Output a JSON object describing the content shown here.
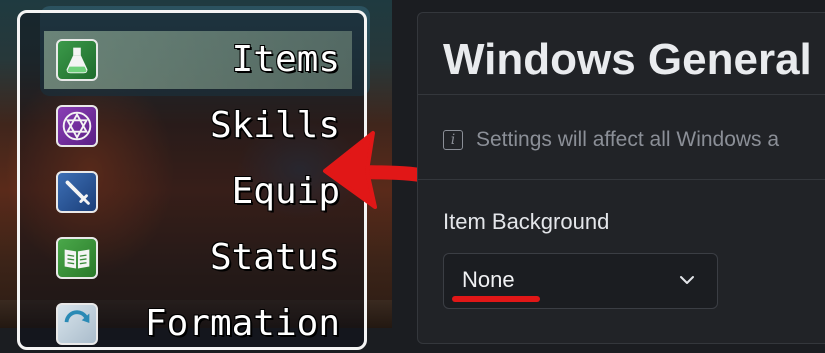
{
  "game_menu": {
    "items": [
      {
        "label": "Items",
        "icon": "potion-icon",
        "selected": true
      },
      {
        "label": "Skills",
        "icon": "hexagram-icon",
        "selected": false
      },
      {
        "label": "Equip",
        "icon": "sword-icon",
        "selected": false
      },
      {
        "label": "Status",
        "icon": "book-icon",
        "selected": false
      },
      {
        "label": "Formation",
        "icon": "cycle-icon",
        "selected": false
      }
    ]
  },
  "annotation": {
    "arrow_color": "#e11717"
  },
  "settings_panel": {
    "title": "Windows General",
    "info_text": "Settings will affect all Windows a",
    "item_background": {
      "label": "Item Background",
      "value": "None"
    }
  },
  "colors": {
    "panel_bg": "#212327",
    "selected_highlight": "#a8c8a8",
    "annotation_red": "#e11717"
  }
}
